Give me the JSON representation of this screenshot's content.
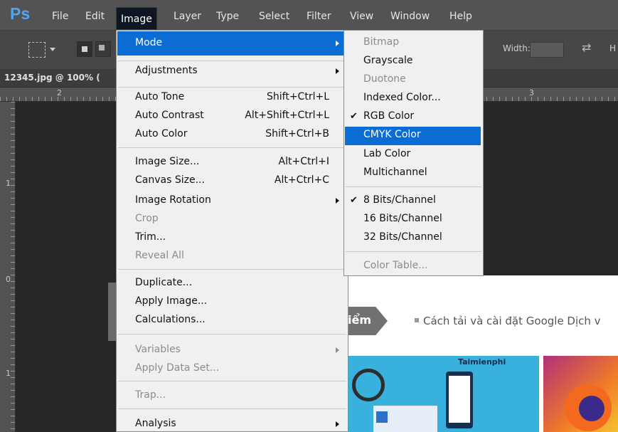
{
  "app": {
    "logo": "Ps"
  },
  "menubar": {
    "items": [
      "File",
      "Edit",
      "Image",
      "Layer",
      "Type",
      "Select",
      "Filter",
      "View",
      "Window",
      "Help"
    ],
    "active": "Image"
  },
  "options_bar": {
    "width_label": "Width:",
    "height_label": "H"
  },
  "document_tab": {
    "label": "12345.jpg @ 100% ("
  },
  "rulers": {
    "top": [
      "2",
      "3"
    ],
    "left": [
      "1",
      "0",
      "1"
    ]
  },
  "image_menu": {
    "mode": "Mode",
    "adjustments": "Adjustments",
    "auto_tone": "Auto Tone",
    "auto_tone_sc": "Shift+Ctrl+L",
    "auto_contrast": "Auto Contrast",
    "auto_contrast_sc": "Alt+Shift+Ctrl+L",
    "auto_color": "Auto Color",
    "auto_color_sc": "Shift+Ctrl+B",
    "image_size": "Image Size...",
    "image_size_sc": "Alt+Ctrl+I",
    "canvas_size": "Canvas Size...",
    "canvas_size_sc": "Alt+Ctrl+C",
    "image_rotation": "Image Rotation",
    "crop": "Crop",
    "trim": "Trim...",
    "reveal_all": "Reveal All",
    "duplicate": "Duplicate...",
    "apply_image": "Apply Image...",
    "calculations": "Calculations...",
    "variables": "Variables",
    "apply_data_set": "Apply Data Set...",
    "trap": "Trap...",
    "analysis": "Analysis"
  },
  "mode_menu": {
    "bitmap": "Bitmap",
    "grayscale": "Grayscale",
    "duotone": "Duotone",
    "indexed_color": "Indexed Color...",
    "rgb_color": "RGB Color",
    "cmyk_color": "CMYK Color",
    "lab_color": "Lab Color",
    "multichannel": "Multichannel",
    "bits8": "8 Bits/Channel",
    "bits16": "16 Bits/Channel",
    "bits32": "32 Bits/Channel",
    "color_table": "Color Table..."
  },
  "checkmark": "✔",
  "document": {
    "tag_text": "iểm",
    "article_link": "Cách tải và cài đặt Google Dịch v",
    "thumb_logo": "Taimienphi"
  },
  "colors": {
    "menu_highlight": "#0b6cd4",
    "menubar_bg": "#535353",
    "ps_logo": "#4ea6f5"
  }
}
